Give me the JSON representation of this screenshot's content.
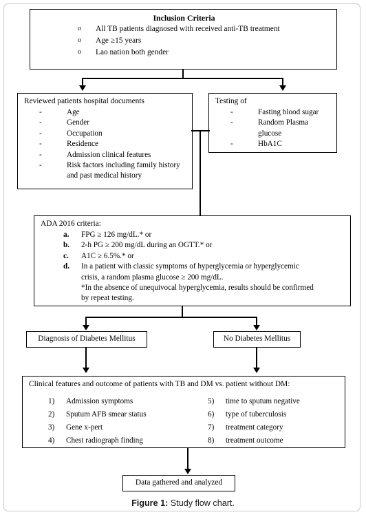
{
  "figure": {
    "caption_label": "Figure 1:",
    "caption_text": " Study flow chart."
  },
  "inclusion": {
    "title": "Inclusion Criteria",
    "bullet_marker": "o",
    "items": [
      "All TB patients diagnosed with received anti-TB treatment",
      "Age ≥15 years",
      "Lao nation both gender"
    ]
  },
  "reviewed": {
    "heading": "Reviewed patients hospital documents",
    "dash": "-",
    "items": [
      "Age",
      "Gender",
      "Occupation",
      "Residence",
      "Admission clinical features",
      "Risk factors including family history"
    ],
    "item_continuation": "and past medical history"
  },
  "testing": {
    "heading": "Testing of",
    "dash": "-",
    "items": [
      "Fasting blood sugar",
      "Random Plasma"
    ],
    "item_continuation": "glucose",
    "last_item": "HbA1C"
  },
  "ada": {
    "heading": "ADA 2016 criteria:",
    "items": [
      {
        "marker": "a.",
        "text": "FPG ≥ 126 mg/dL.* or"
      },
      {
        "marker": "b.",
        "text": "2-h PG ≥ 200 mg/dL during an OGTT.* or"
      },
      {
        "marker": "c.",
        "text": "A1C ≥ 6.5%.* or"
      },
      {
        "marker": "d.",
        "text": "In a patient with classic symptoms of hyperglycemia or hyperglycemic"
      }
    ],
    "continuation_1": "crisis, a random plasma glucose ≥ 200 mg/dL.",
    "footnote_1": "*In the absence of unequivocal hyperglycemia, results should be confirmed",
    "footnote_2": "by repeat testing."
  },
  "outcome_boxes": {
    "diagnosis": "Diagnosis of Diabetes Mellitus",
    "no_diagnosis": "No Diabetes Mellitus"
  },
  "clinical": {
    "heading": "Clinical features and outcome of patients with TB and DM vs. patient without DM:",
    "left_items": [
      {
        "marker": "1)",
        "text": "Admission symptoms"
      },
      {
        "marker": "2)",
        "text": "Sputum AFB smear status"
      },
      {
        "marker": "3)",
        "text": "Gene x-pert"
      },
      {
        "marker": "4)",
        "text": "Chest radiograph finding"
      }
    ],
    "right_items": [
      {
        "marker": "5)",
        "text": "time to sputum negative"
      },
      {
        "marker": "6)",
        "text": "type of tuberculosis"
      },
      {
        "marker": "7)",
        "text": "treatment category"
      },
      {
        "marker": "8)",
        "text": "treatment outcome"
      }
    ]
  },
  "final": {
    "label": "Data gathered and analyzed"
  },
  "colors": {
    "line": "#000000",
    "frame": "#c8c8c8",
    "text": "#000000"
  }
}
